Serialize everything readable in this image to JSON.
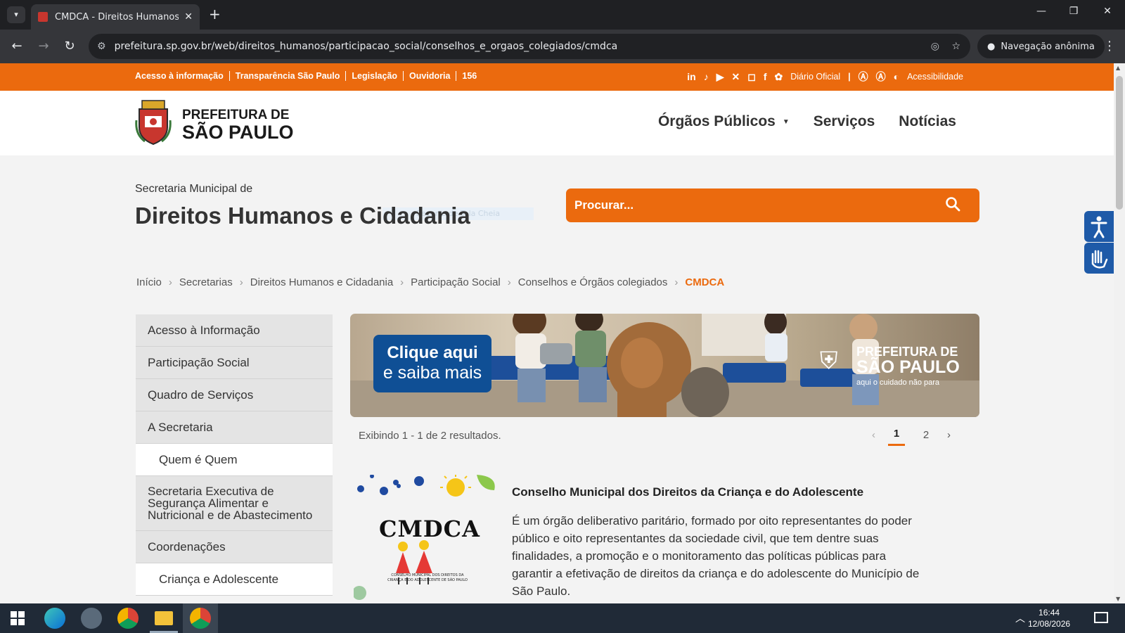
{
  "browser": {
    "tab_title": "CMDCA - Direitos Humanos e C",
    "url": "prefeitura.sp.gov.br/web/direitos_humanos/participacao_social/conselhos_e_orgaos_colegiados/cmdca",
    "incognito_label": "Navegação anônima",
    "new_tab": "+"
  },
  "topbar": {
    "links": [
      "Acesso à informação",
      "Transparência São Paulo",
      "Legislação",
      "Ouvidoria",
      "156"
    ],
    "diario": "Diário Oficial",
    "accessibility": "Acessibilidade",
    "social_icons": [
      "linkedin-icon",
      "tiktok-icon",
      "youtube-icon",
      "x-icon",
      "instagram-icon",
      "facebook-icon",
      "flickr-icon"
    ]
  },
  "header": {
    "logo_line1": "PREFEITURA DE",
    "logo_line2": "SÃO PAULO",
    "nav": [
      "Órgãos Públicos",
      "Serviços",
      "Notícias"
    ]
  },
  "ghost_text": "Recorte de Tela Cheia",
  "section": {
    "subtitle": "Secretaria Municipal de",
    "title": "Direitos Humanos e Cidadania",
    "search_placeholder": "Procurar..."
  },
  "breadcrumb": [
    "Início",
    "Secretarias",
    "Direitos Humanos e Cidadania",
    "Participação Social",
    "Conselhos e Órgãos colegiados",
    "CMDCA"
  ],
  "sidebar": {
    "items": [
      "Acesso à Informação",
      "Participação Social",
      "Quadro de Serviços",
      "A Secretaria",
      "Quem é Quem",
      "Secretaria Executiva de Segurança Alimentar e Nutricional e de Abastecimento",
      "Coordenações",
      "Criança e Adolescente"
    ]
  },
  "banner": {
    "cta_line1": "Clique aqui",
    "cta_line2": "e saiba mais",
    "brand_line1": "PREFEITURA DE",
    "brand_line2": "SÃO PAULO",
    "brand_tagline": "aqui o cuidado não para"
  },
  "results": {
    "text": "Exibindo 1 - 1 de 2 resultados.",
    "pages": [
      "1",
      "2"
    ],
    "current": "1"
  },
  "article": {
    "logo_text": "CMDCA",
    "logo_caption": "CONSELHO MUNICIPAL DOS DIREITOS DA CRIANÇA E DO ADOLESCENTE DE SÃO PAULO",
    "title": "Conselho Municipal dos Direitos da Criança e do Adolescente",
    "body": "É um órgão deliberativo paritário, formado por oito representantes do poder público e oito representantes da sociedade civil, que tem dentre suas finalidades, a promoção e o monitoramento das políticas públicas para garantir a efetivação de direitos da criança e do adolescente do Município de São Paulo."
  },
  "taskbar": {
    "time": "16:44",
    "date": "12/08/2026"
  },
  "colors": {
    "accent": "#eb6a0e",
    "acc_blue": "#1e5aa8"
  }
}
